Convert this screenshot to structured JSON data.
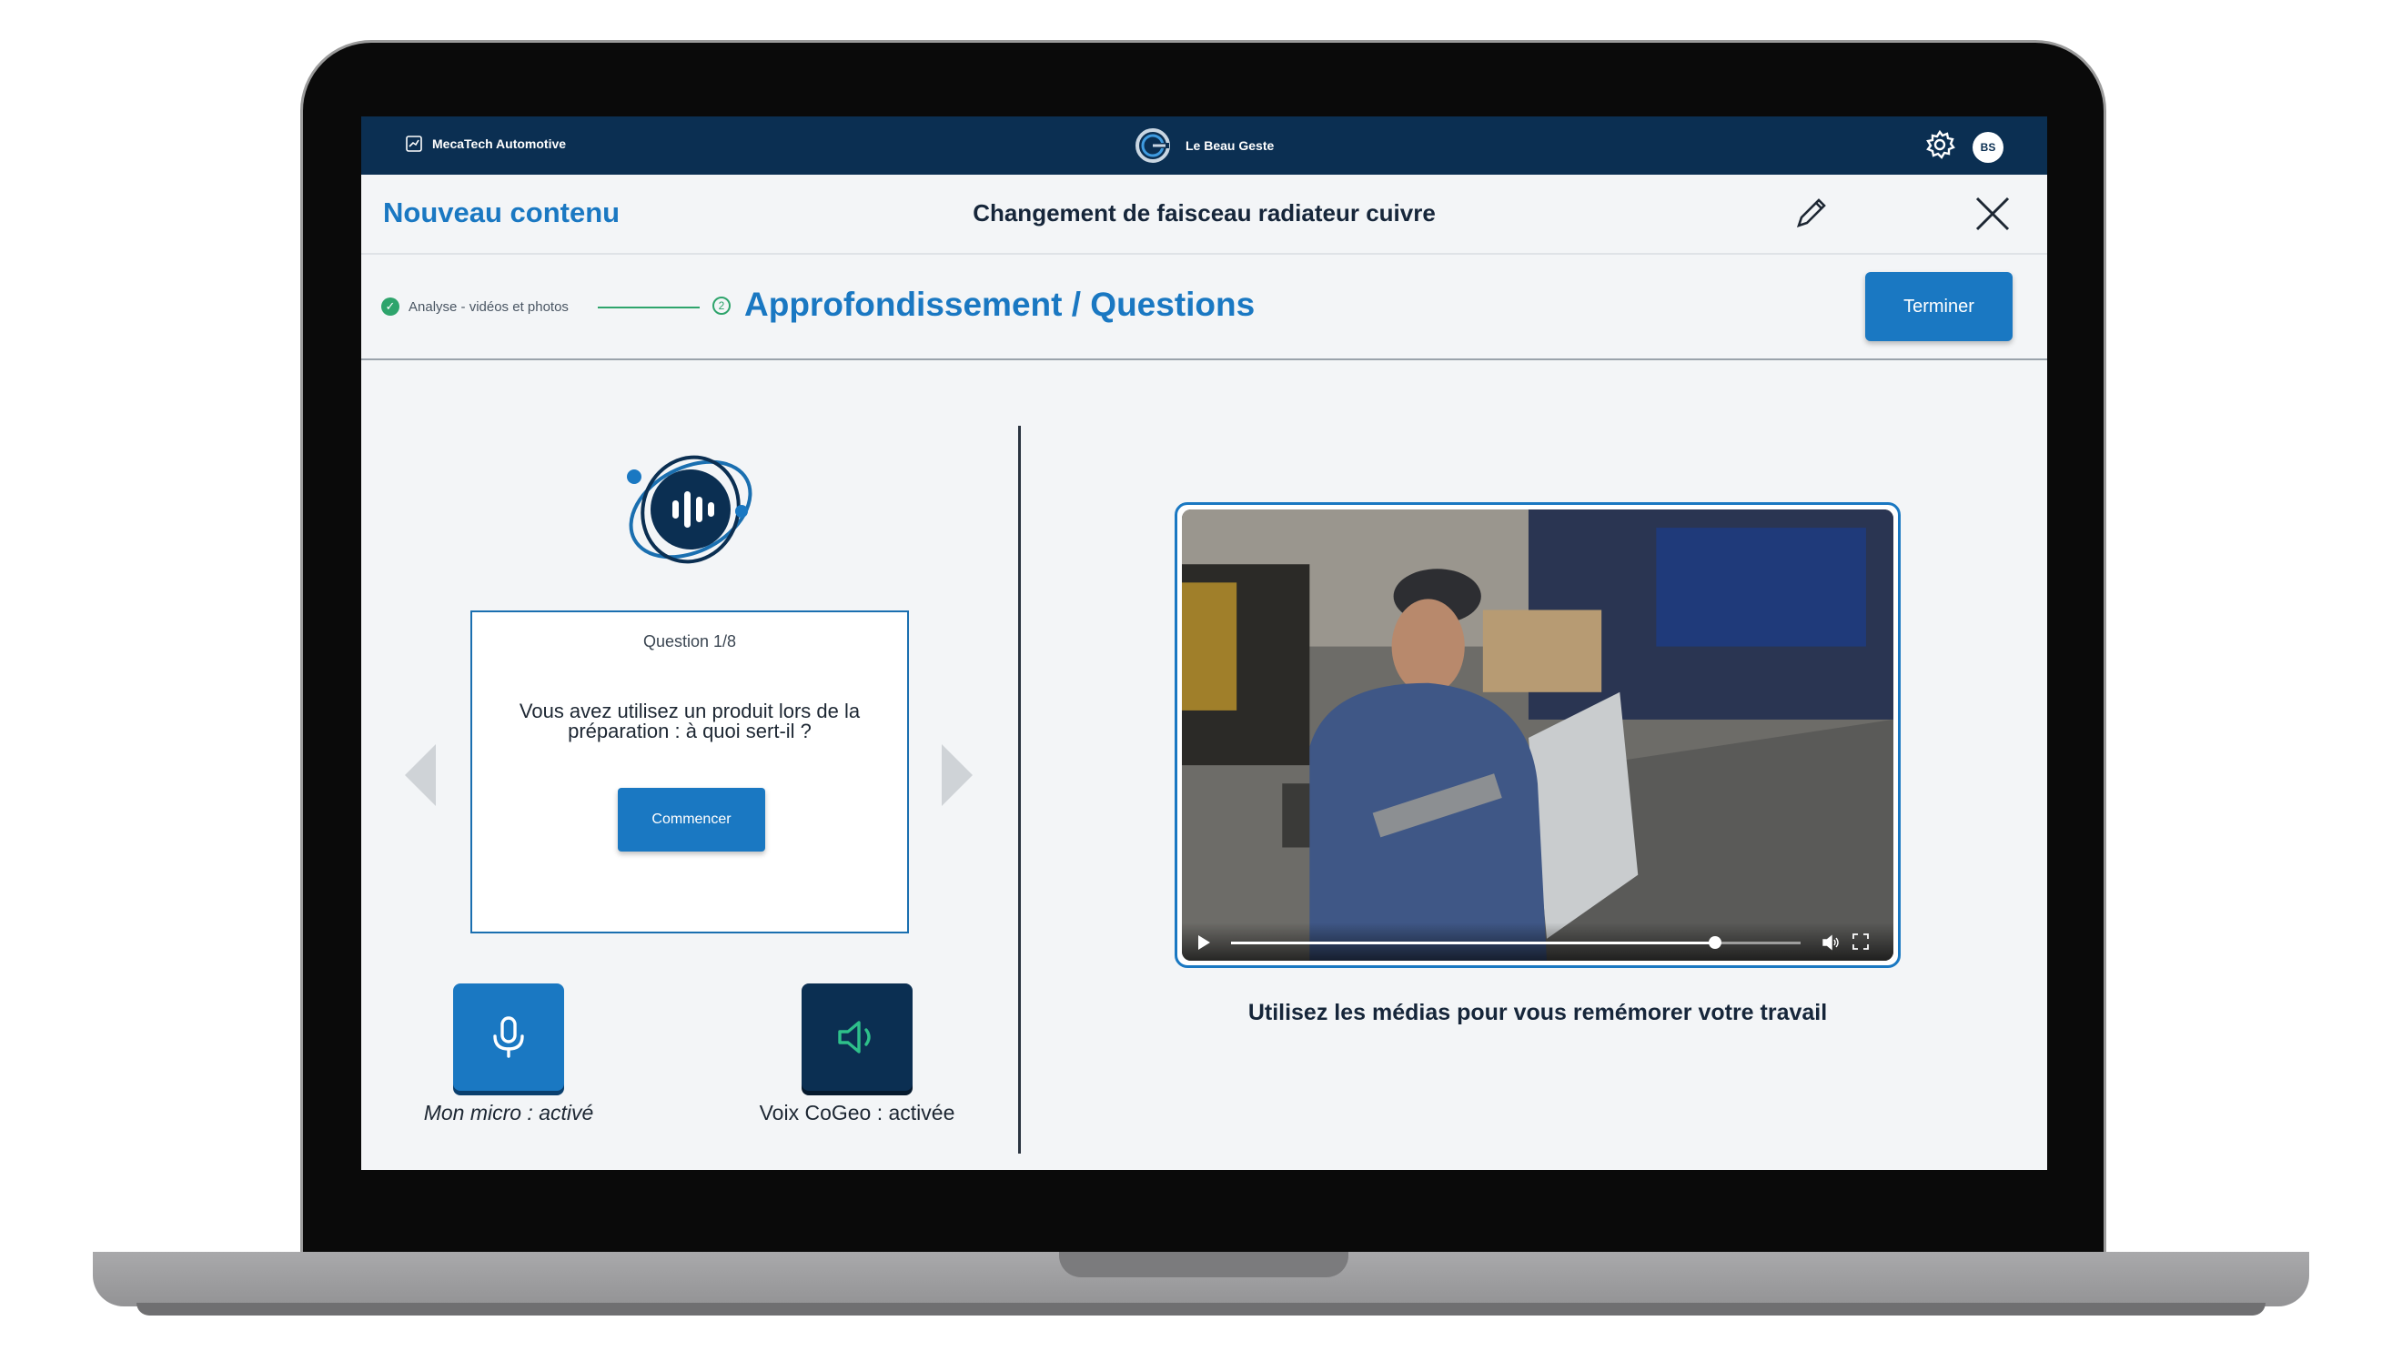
{
  "topbar": {
    "organization": "MecaTech Automotive",
    "brand": "Le Beau Geste",
    "avatar_initials": "BS",
    "background_color": "#0b2f52"
  },
  "header": {
    "section_title": "Nouveau contenu",
    "content_title": "Changement de faisceau radiateur cuivre"
  },
  "stepper": {
    "steps": [
      {
        "label": "Analyse - vidéos et photos",
        "status": "completed"
      },
      {
        "number": "2",
        "label": "Approfondissement / Questions",
        "status": "current"
      }
    ],
    "finish_label": "Terminer"
  },
  "question": {
    "counter": "Question 1/8",
    "text": "Vous avez utilisez un produit lors de la préparation : à quoi sert-il ?",
    "start_label": "Commencer"
  },
  "controls": {
    "mic_label": "Mon micro : activé",
    "voice_label": "Voix CoGeo : activée"
  },
  "media": {
    "caption": "Utilisez les médias pour vous remémorer votre travail",
    "progress": 0.85
  },
  "colors": {
    "accent": "#1a78c2",
    "navy": "#0b2f52",
    "success": "#2ea46c",
    "voice_icon": "#2ec08a"
  },
  "icons": {
    "org": "chart-icon",
    "brand": "cogeo-logo",
    "settings": "gear-icon",
    "edit": "pencil-icon",
    "close": "close-icon",
    "mic": "microphone-icon",
    "voice": "speaker-icon"
  }
}
